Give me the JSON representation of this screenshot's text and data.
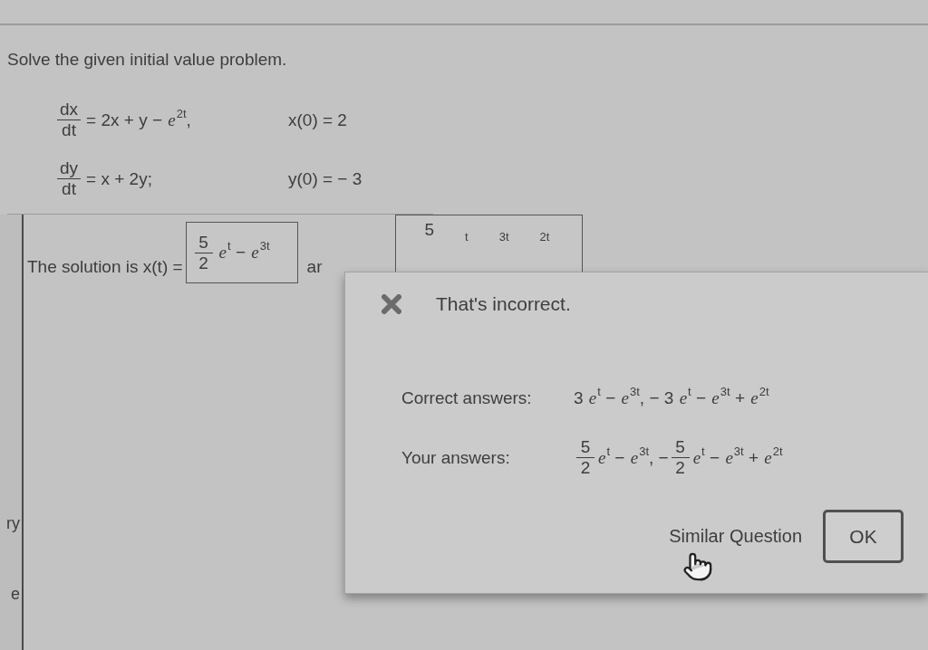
{
  "instruction": "Solve the given initial value problem.",
  "equations": [
    {
      "numerator": "dx",
      "denominator": "dt",
      "rhs": "= 2x + y − *e*$^{2t}$,",
      "condition": "x(0) = 2"
    },
    {
      "numerator": "dy",
      "denominator": "dt",
      "rhs": "= x + 2y;",
      "condition": "y(0) = − 3"
    }
  ],
  "solution": {
    "lead": "The solution is x(t) =",
    "x_answer": [
      {
        "kind": "frac",
        "numerator": "5",
        "denominator": "2"
      },
      {
        "kind": "text",
        "text": "*e*$^{t}$ − *e*$^{3t}$"
      }
    ],
    "connector": "ar",
    "y_answer_visible": [
      {
        "kind": "numerator",
        "text": "5"
      },
      {
        "kind": "exponent",
        "text": "t"
      },
      {
        "kind": "exponent",
        "text": "3t"
      },
      {
        "kind": "exponent",
        "text": "2t"
      }
    ]
  },
  "feedback": {
    "message": "That's incorrect.",
    "rows": [
      {
        "label": "Correct answers:",
        "parts": [
          {
            "kind": "text",
            "text": "3 *e*$^{t}$ − *e*$^{3t}$, − 3 *e*$^{t}$ − *e*$^{3t}$ + *e*$^{2t}$"
          }
        ]
      },
      {
        "label": "Your answers:",
        "parts": [
          {
            "kind": "frac",
            "numerator": "5",
            "denominator": "2"
          },
          {
            "kind": "text",
            "text": "*e*$^{t}$ − *e*$^{3t}$, −"
          },
          {
            "kind": "frac",
            "numerator": "5",
            "denominator": "2"
          },
          {
            "kind": "text",
            "text": "*e*$^{t}$ − *e*$^{3t}$ + *e*$^{2t}$"
          }
        ]
      }
    ],
    "buttons": [
      {
        "kind": "link",
        "label": "Similar Question"
      },
      {
        "kind": "button",
        "label": "OK"
      }
    ]
  },
  "side_panel": [
    "ry",
    "e"
  ]
}
